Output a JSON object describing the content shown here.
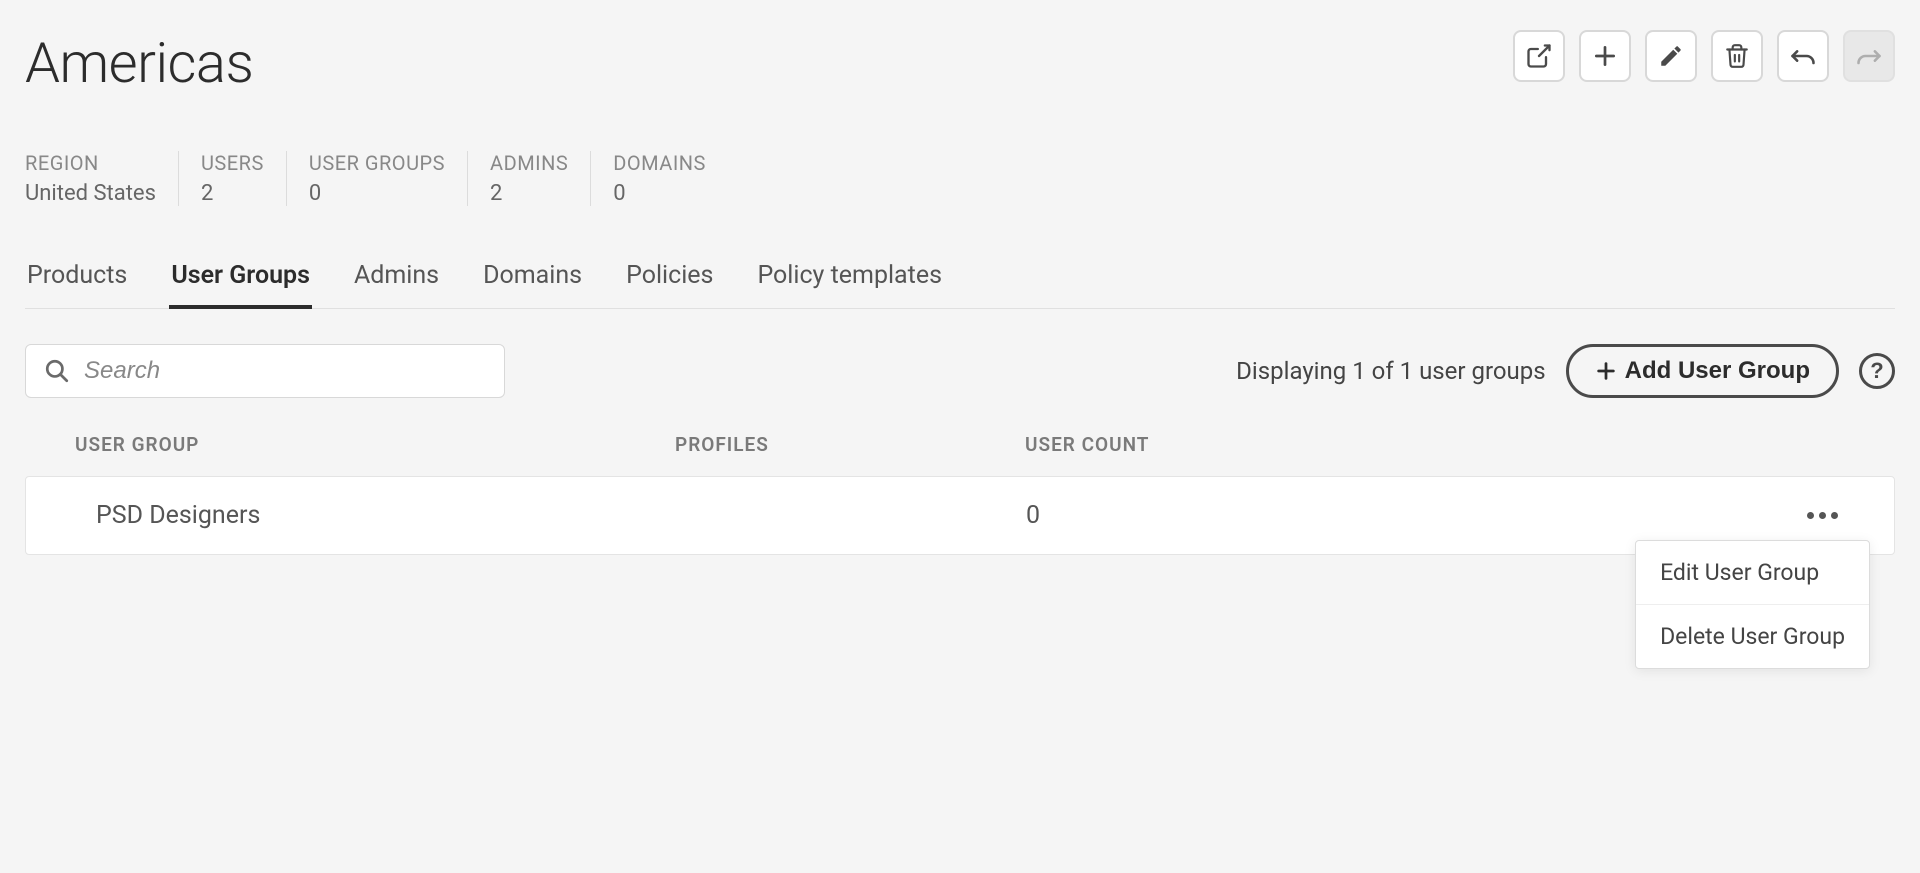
{
  "title": "Americas",
  "stats": {
    "region": {
      "label": "REGION",
      "value": "United States"
    },
    "users": {
      "label": "USERS",
      "value": "2"
    },
    "userGroups": {
      "label": "USER GROUPS",
      "value": "0"
    },
    "admins": {
      "label": "ADMINS",
      "value": "2"
    },
    "domains": {
      "label": "DOMAINS",
      "value": "0"
    }
  },
  "tabs": {
    "products": "Products",
    "userGroups": "User Groups",
    "admins": "Admins",
    "domains": "Domains",
    "policies": "Policies",
    "policyTemplates": "Policy templates"
  },
  "search": {
    "placeholder": "Search"
  },
  "displayText": "Displaying 1 of 1 user groups",
  "addButton": "Add User Group",
  "table": {
    "headers": {
      "name": "USER GROUP",
      "profiles": "PROFILES",
      "count": "USER COUNT"
    },
    "rows": [
      {
        "name": "PSD Designers",
        "profiles": "",
        "count": "0"
      }
    ]
  },
  "dropdown": {
    "edit": "Edit User Group",
    "delete": "Delete User Group"
  }
}
